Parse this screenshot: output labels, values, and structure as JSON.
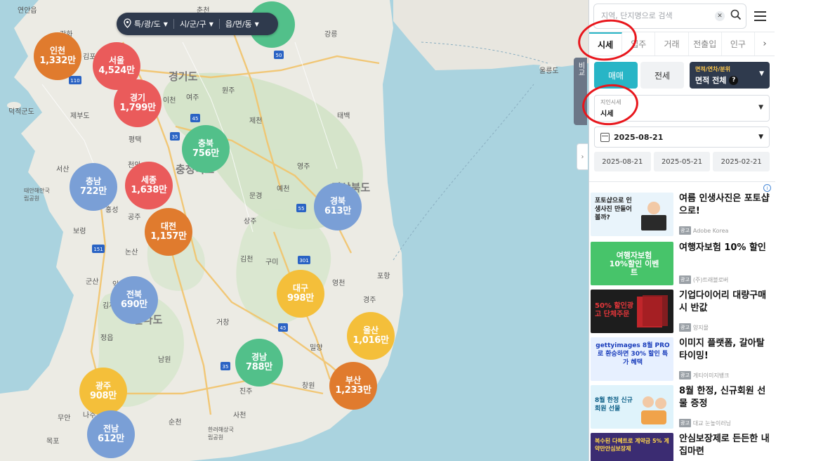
{
  "location_bar": {
    "level1": "특/광/도",
    "level2": "시/군/구",
    "level3": "읍/면/동"
  },
  "clusters": [
    {
      "name": "인천",
      "value": "1,332만",
      "color": "#e07b2e"
    },
    {
      "name": "서울",
      "value": "4,524만",
      "color": "#ea5b5b"
    },
    {
      "name": "경기",
      "value": "1,799만",
      "color": "#ea5b5b"
    },
    {
      "name": "충북",
      "value": "756만",
      "color": "#52c08a"
    },
    {
      "name": "충남",
      "value": "722만",
      "color": "#7a9fd6"
    },
    {
      "name": "세종",
      "value": "1,638만",
      "color": "#ea5b5b"
    },
    {
      "name": "대전",
      "value": "1,157만",
      "color": "#e07b2e"
    },
    {
      "name": "경북",
      "value": "613만",
      "color": "#7a9fd6"
    },
    {
      "name": "전북",
      "value": "690만",
      "color": "#7a9fd6"
    },
    {
      "name": "대구",
      "value": "998만",
      "color": "#f4bf3a"
    },
    {
      "name": "울산",
      "value": "1,016만",
      "color": "#f4bf3a"
    },
    {
      "name": "경남",
      "value": "788만",
      "color": "#52c08a"
    },
    {
      "name": "부산",
      "value": "1,233만",
      "color": "#e07b2e"
    },
    {
      "name": "광주",
      "value": "908만",
      "color": "#f4bf3a"
    },
    {
      "name": "전남",
      "value": "612만",
      "color": "#7a9fd6"
    },
    {
      "name": "",
      "value": "",
      "color": "#52c08a"
    }
  ],
  "places": [
    "연안읍",
    "강화",
    "김포",
    "덕적군도",
    "제부도",
    "이천",
    "여주",
    "원주",
    "경기도",
    "평택",
    "제천",
    "태백",
    "천안",
    "충청북도",
    "영주",
    "서산",
    "태안해안국립공원",
    "보령",
    "홍성",
    "공주",
    "상주",
    "문경",
    "예천",
    "논산",
    "군산",
    "익산",
    "김제",
    "김천",
    "구미",
    "포항",
    "영천",
    "경주",
    "거창",
    "정읍",
    "남원",
    "밀양",
    "창원",
    "사천",
    "진주",
    "목포",
    "무안",
    "나주",
    "순천",
    "한려해상국립공원",
    "경상북도",
    "강릉",
    "춘천",
    "울릉도",
    "전라도"
  ],
  "compare_tab": "비교",
  "search": {
    "placeholder": "지역, 단지명으로 검색"
  },
  "tabs": [
    "시세",
    "입주",
    "거래",
    "전출입",
    "인구"
  ],
  "trade": {
    "sale": "매매",
    "jeonse": "전세",
    "area_label": "면적/연차/분위",
    "area_value": "면적 전체",
    "help": "?"
  },
  "price_type": {
    "label": "지인시세",
    "value": "시세"
  },
  "date": {
    "selected": "2025-08-21",
    "quick": [
      "2025-08-21",
      "2025-05-21",
      "2025-02-21"
    ]
  },
  "ads": [
    {
      "thumb_text": "포토샵으로 인생사진 만들어볼까?",
      "title": "여름 인생사진은 포토샵으로!",
      "source": "Adobe Korea",
      "bg": "#e9f4fb",
      "fg": "#1a1a1a"
    },
    {
      "thumb_text": "여행자보험 10%할인 이벤트",
      "title": "여행자보험 10% 할인",
      "source": "(주)트래블로버",
      "bg": "#47c46a",
      "fg": "#ffffff"
    },
    {
      "thumb_text": "50% 할인광고 단체주문",
      "title": "기업다이어리 대량구매 시 반값",
      "source": "양지몰",
      "bg": "#1d1d1d",
      "fg": "#e8373b"
    },
    {
      "thumb_text": "gettyimages 8월 PRO로 환승하면 30% 할인 특가 혜택",
      "title": "이미지 플랫폼, 갈아탈 타이밍!",
      "source": "게티이미지뱅크",
      "bg": "#e7f0ff",
      "fg": "#1a3dbb"
    },
    {
      "thumb_text": "8월 한정 신규회원 선물",
      "title": "8월 한정, 신규회원 선물 증정",
      "source": "대교 눈높이러닝",
      "bg": "#dff3fb",
      "fg": "#0b5e86"
    },
    {
      "thumb_text": "복수된 다혜트로 계약금 5% 계약만안심보장제",
      "title": "안심보장제로 든든한 내집마련",
      "source": "",
      "bg": "#3b2c72",
      "fg": "#ffd54a"
    }
  ],
  "ad_badge": "광고",
  "colors": {
    "accent": "#28b5c6",
    "dark": "#2f3a4d",
    "annotation": "#e8161c"
  }
}
